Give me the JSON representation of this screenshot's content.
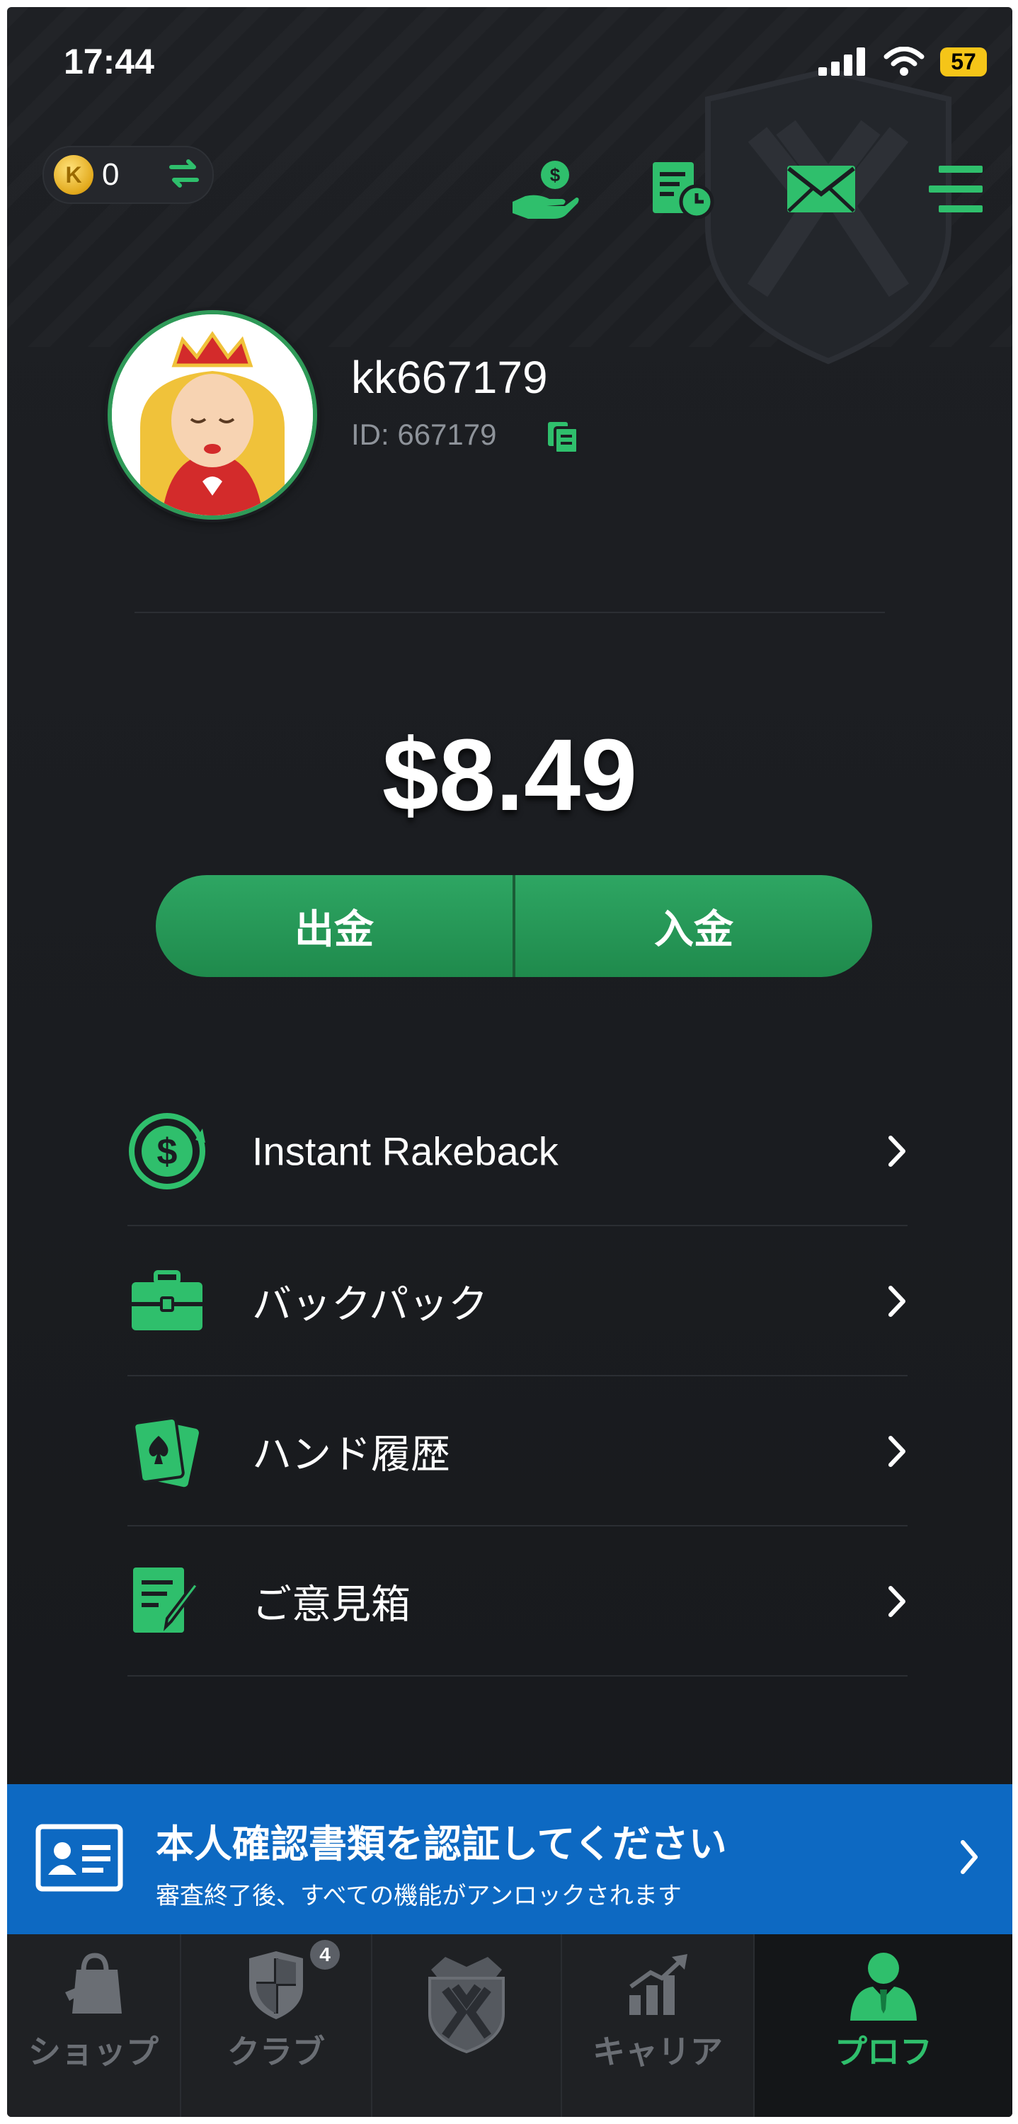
{
  "status_bar": {
    "time": "17:44",
    "battery": "57"
  },
  "wallet": {
    "coin_symbol": "K",
    "coin_balance": "0"
  },
  "header_icons": [
    "cashier-hand-icon",
    "history-clock-icon",
    "mail-icon",
    "menu-icon"
  ],
  "profile": {
    "username": "kk667179",
    "id_label": "ID: 667179"
  },
  "balance": "$8.49",
  "actions": {
    "withdraw": "出金",
    "deposit": "入金"
  },
  "menu": [
    {
      "label": "Instant Rakeback",
      "icon": "rakeback-dollar-icon"
    },
    {
      "label": "バックパック",
      "icon": "briefcase-icon"
    },
    {
      "label": "ハンド履歴",
      "icon": "cards-icon"
    },
    {
      "label": "ご意見箱",
      "icon": "feedback-edit-icon"
    }
  ],
  "banner": {
    "title": "本人確認書類を認証してください",
    "subtitle": "審査終了後、すべての機能がアンロックされます"
  },
  "tabs": [
    {
      "label": "ショップ",
      "icon": "shop-bag-icon"
    },
    {
      "label": "クラブ",
      "icon": "club-shield-icon",
      "badge": "4"
    },
    {
      "label": "",
      "icon": "kk-logo-icon"
    },
    {
      "label": "キャリア",
      "icon": "career-chart-icon"
    },
    {
      "label": "プロフ",
      "icon": "profile-person-icon",
      "active": true
    }
  ],
  "colors": {
    "accent": "#2fbf6c",
    "button": "#249556",
    "banner": "#0d69c2",
    "background": "#1b1d21"
  }
}
